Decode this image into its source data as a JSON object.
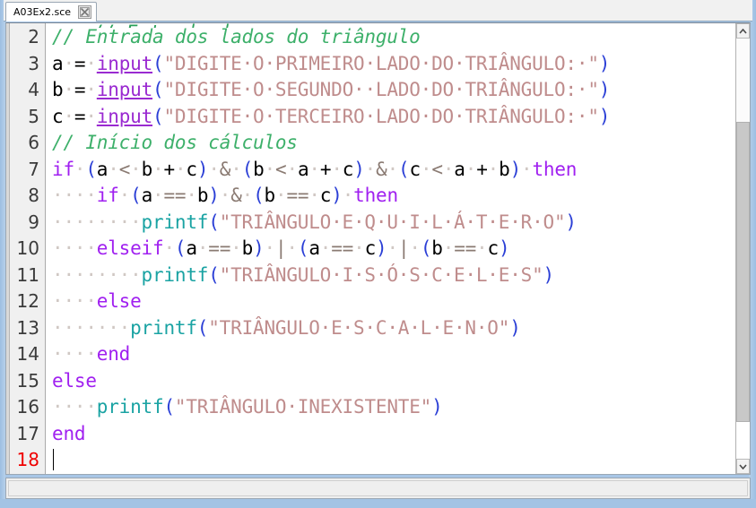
{
  "window": {
    "accent_color": "#a8c6e6"
  },
  "tab": {
    "label": "A03Ex2.sce",
    "close_icon": "close-icon"
  },
  "editor": {
    "first_visible_line": 2,
    "current_line": 18,
    "colors": {
      "comment": "#3db06a",
      "keyword": "#a020f0",
      "function": "#9a2ad1",
      "builtin": "#1aa3a3",
      "string": "#bf8c8c",
      "paren": "#2b3fd6",
      "operator": "#8a7a72",
      "plain": "#000000",
      "whitespace_dot": "#d0c8c4",
      "current_line_number": "#ef0000"
    },
    "partial_top_line_text": "// Entrada dos",
    "lines": [
      {
        "number": "2",
        "tokens": [
          {
            "t": "comment",
            "s": "// Entrada dos lados do triângulo"
          }
        ]
      },
      {
        "number": "3",
        "tokens": [
          {
            "t": "plain",
            "s": "a"
          },
          {
            "t": "ws",
            "s": "·"
          },
          {
            "t": "plain",
            "s": "="
          },
          {
            "t": "ws",
            "s": "·"
          },
          {
            "t": "fn",
            "s": "input"
          },
          {
            "t": "paren",
            "s": "("
          },
          {
            "t": "string",
            "s": "\"DIGITE·O·PRIMEIRO·LADO·DO·TRIÂNGULO:·\""
          },
          {
            "t": "paren",
            "s": ")"
          }
        ]
      },
      {
        "number": "4",
        "tokens": [
          {
            "t": "plain",
            "s": "b"
          },
          {
            "t": "ws",
            "s": "·"
          },
          {
            "t": "plain",
            "s": "="
          },
          {
            "t": "ws",
            "s": "·"
          },
          {
            "t": "fn",
            "s": "input"
          },
          {
            "t": "paren",
            "s": "("
          },
          {
            "t": "string",
            "s": "\"DIGITE·O·SEGUNDO··LADO·DO·TRIÂNGULO:·\""
          },
          {
            "t": "paren",
            "s": ")"
          }
        ]
      },
      {
        "number": "5",
        "tokens": [
          {
            "t": "plain",
            "s": "c"
          },
          {
            "t": "ws",
            "s": "·"
          },
          {
            "t": "plain",
            "s": "="
          },
          {
            "t": "ws",
            "s": "·"
          },
          {
            "t": "fn",
            "s": "input"
          },
          {
            "t": "paren",
            "s": "("
          },
          {
            "t": "string",
            "s": "\"DIGITE·O·TERCEIRO·LADO·DO·TRIÂNGULO:·\""
          },
          {
            "t": "paren",
            "s": ")"
          }
        ]
      },
      {
        "number": "6",
        "tokens": [
          {
            "t": "comment",
            "s": "// Início dos cálculos"
          }
        ]
      },
      {
        "number": "7",
        "tokens": [
          {
            "t": "keyword",
            "s": "if"
          },
          {
            "t": "ws",
            "s": "·"
          },
          {
            "t": "paren",
            "s": "("
          },
          {
            "t": "plain",
            "s": "a"
          },
          {
            "t": "ws",
            "s": "·"
          },
          {
            "t": "op",
            "s": "<"
          },
          {
            "t": "ws",
            "s": "·"
          },
          {
            "t": "plain",
            "s": "b"
          },
          {
            "t": "ws",
            "s": "·"
          },
          {
            "t": "plain",
            "s": "+"
          },
          {
            "t": "ws",
            "s": "·"
          },
          {
            "t": "plain",
            "s": "c"
          },
          {
            "t": "paren",
            "s": ")"
          },
          {
            "t": "ws",
            "s": "·"
          },
          {
            "t": "op",
            "s": "&"
          },
          {
            "t": "ws",
            "s": "·"
          },
          {
            "t": "paren",
            "s": "("
          },
          {
            "t": "plain",
            "s": "b"
          },
          {
            "t": "ws",
            "s": "·"
          },
          {
            "t": "op",
            "s": "<"
          },
          {
            "t": "ws",
            "s": "·"
          },
          {
            "t": "plain",
            "s": "a"
          },
          {
            "t": "ws",
            "s": "·"
          },
          {
            "t": "plain",
            "s": "+"
          },
          {
            "t": "ws",
            "s": "·"
          },
          {
            "t": "plain",
            "s": "c"
          },
          {
            "t": "paren",
            "s": ")"
          },
          {
            "t": "ws",
            "s": "·"
          },
          {
            "t": "op",
            "s": "&"
          },
          {
            "t": "ws",
            "s": "·"
          },
          {
            "t": "paren",
            "s": "("
          },
          {
            "t": "plain",
            "s": "c"
          },
          {
            "t": "ws",
            "s": "·"
          },
          {
            "t": "op",
            "s": "<"
          },
          {
            "t": "ws",
            "s": "·"
          },
          {
            "t": "plain",
            "s": "a"
          },
          {
            "t": "ws",
            "s": "·"
          },
          {
            "t": "plain",
            "s": "+"
          },
          {
            "t": "ws",
            "s": "·"
          },
          {
            "t": "plain",
            "s": "b"
          },
          {
            "t": "paren",
            "s": ")"
          },
          {
            "t": "ws",
            "s": "·"
          },
          {
            "t": "keyword",
            "s": "then"
          }
        ]
      },
      {
        "number": "8",
        "tokens": [
          {
            "t": "ws",
            "s": "····"
          },
          {
            "t": "keyword",
            "s": "if"
          },
          {
            "t": "ws",
            "s": "·"
          },
          {
            "t": "paren",
            "s": "("
          },
          {
            "t": "plain",
            "s": "a"
          },
          {
            "t": "ws",
            "s": "·"
          },
          {
            "t": "op",
            "s": "=="
          },
          {
            "t": "ws",
            "s": "·"
          },
          {
            "t": "plain",
            "s": "b"
          },
          {
            "t": "paren",
            "s": ")"
          },
          {
            "t": "ws",
            "s": "·"
          },
          {
            "t": "op",
            "s": "&"
          },
          {
            "t": "ws",
            "s": "·"
          },
          {
            "t": "paren",
            "s": "("
          },
          {
            "t": "plain",
            "s": "b"
          },
          {
            "t": "ws",
            "s": "·"
          },
          {
            "t": "op",
            "s": "=="
          },
          {
            "t": "ws",
            "s": "·"
          },
          {
            "t": "plain",
            "s": "c"
          },
          {
            "t": "paren",
            "s": ")"
          },
          {
            "t": "ws",
            "s": "·"
          },
          {
            "t": "keyword",
            "s": "then"
          }
        ]
      },
      {
        "number": "9",
        "tokens": [
          {
            "t": "ws",
            "s": "········"
          },
          {
            "t": "builtin",
            "s": "printf"
          },
          {
            "t": "paren",
            "s": "("
          },
          {
            "t": "string",
            "s": "\"TRIÂNGULO·E·Q·U·I·L·Á·T·E·R·O\""
          },
          {
            "t": "paren",
            "s": ")"
          }
        ]
      },
      {
        "number": "10",
        "tokens": [
          {
            "t": "ws",
            "s": "····"
          },
          {
            "t": "keyword",
            "s": "elseif"
          },
          {
            "t": "ws",
            "s": "·"
          },
          {
            "t": "paren",
            "s": "("
          },
          {
            "t": "plain",
            "s": "a"
          },
          {
            "t": "ws",
            "s": "·"
          },
          {
            "t": "op",
            "s": "=="
          },
          {
            "t": "ws",
            "s": "·"
          },
          {
            "t": "plain",
            "s": "b"
          },
          {
            "t": "paren",
            "s": ")"
          },
          {
            "t": "ws",
            "s": "·"
          },
          {
            "t": "op",
            "s": "|"
          },
          {
            "t": "ws",
            "s": "·"
          },
          {
            "t": "paren",
            "s": "("
          },
          {
            "t": "plain",
            "s": "a"
          },
          {
            "t": "ws",
            "s": "·"
          },
          {
            "t": "op",
            "s": "=="
          },
          {
            "t": "ws",
            "s": "·"
          },
          {
            "t": "plain",
            "s": "c"
          },
          {
            "t": "paren",
            "s": ")"
          },
          {
            "t": "ws",
            "s": "·"
          },
          {
            "t": "op",
            "s": "|"
          },
          {
            "t": "ws",
            "s": "·"
          },
          {
            "t": "paren",
            "s": "("
          },
          {
            "t": "plain",
            "s": "b"
          },
          {
            "t": "ws",
            "s": "·"
          },
          {
            "t": "op",
            "s": "=="
          },
          {
            "t": "ws",
            "s": "·"
          },
          {
            "t": "plain",
            "s": "c"
          },
          {
            "t": "paren",
            "s": ")"
          }
        ]
      },
      {
        "number": "11",
        "tokens": [
          {
            "t": "ws",
            "s": "········"
          },
          {
            "t": "builtin",
            "s": "printf"
          },
          {
            "t": "paren",
            "s": "("
          },
          {
            "t": "string",
            "s": "\"TRIÂNGULO·I·S·Ó·S·C·E·L·E·S\""
          },
          {
            "t": "paren",
            "s": ")"
          }
        ]
      },
      {
        "number": "12",
        "tokens": [
          {
            "t": "ws",
            "s": "····"
          },
          {
            "t": "keyword",
            "s": "else"
          }
        ]
      },
      {
        "number": "13",
        "tokens": [
          {
            "t": "ws",
            "s": "·······"
          },
          {
            "t": "builtin",
            "s": "printf"
          },
          {
            "t": "paren",
            "s": "("
          },
          {
            "t": "string",
            "s": "\"TRIÂNGULO·E·S·C·A·L·E·N·O\""
          },
          {
            "t": "paren",
            "s": ")"
          }
        ]
      },
      {
        "number": "14",
        "tokens": [
          {
            "t": "ws",
            "s": "····"
          },
          {
            "t": "keyword",
            "s": "end"
          }
        ]
      },
      {
        "number": "15",
        "tokens": [
          {
            "t": "keyword",
            "s": "else"
          }
        ]
      },
      {
        "number": "16",
        "tokens": [
          {
            "t": "ws",
            "s": "····"
          },
          {
            "t": "builtin",
            "s": "printf"
          },
          {
            "t": "paren",
            "s": "("
          },
          {
            "t": "string",
            "s": "\"TRIÂNGULO·INEXISTENTE\""
          },
          {
            "t": "paren",
            "s": ")"
          }
        ]
      },
      {
        "number": "17",
        "tokens": [
          {
            "t": "keyword",
            "s": "end"
          }
        ]
      },
      {
        "number": "18",
        "tokens": [],
        "has_caret": true
      }
    ]
  },
  "scrollbar": {
    "up_arrow_icon": "chevron-up-icon",
    "down_arrow_icon": "chevron-down-icon"
  },
  "statusbar": {
    "text": ""
  }
}
